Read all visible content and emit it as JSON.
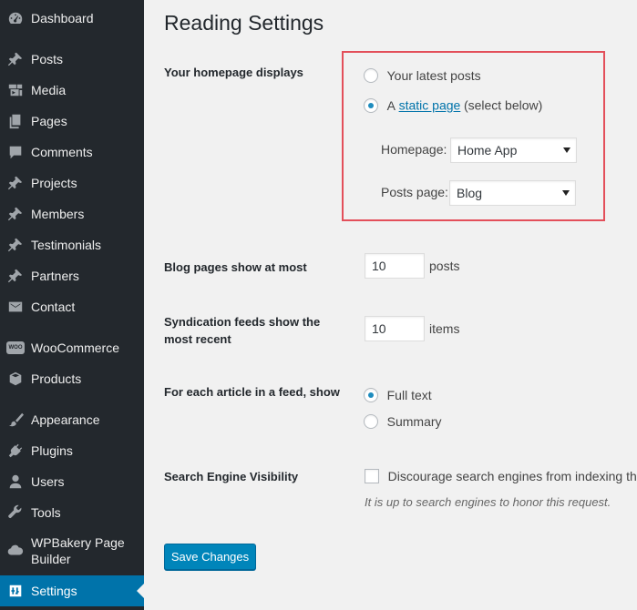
{
  "sidebar": {
    "items": [
      {
        "label": "Dashboard",
        "icon": "dashboard-icon"
      },
      {
        "label": "Posts",
        "icon": "pin-icon"
      },
      {
        "label": "Media",
        "icon": "media-icon"
      },
      {
        "label": "Pages",
        "icon": "pages-icon"
      },
      {
        "label": "Comments",
        "icon": "comment-icon"
      },
      {
        "label": "Projects",
        "icon": "pin-icon"
      },
      {
        "label": "Members",
        "icon": "pin-icon"
      },
      {
        "label": "Testimonials",
        "icon": "pin-icon"
      },
      {
        "label": "Partners",
        "icon": "pin-icon"
      },
      {
        "label": "Contact",
        "icon": "mail-icon"
      },
      {
        "label": "WooCommerce",
        "icon": "woocommerce-icon",
        "icon_text": "WOO"
      },
      {
        "label": "Products",
        "icon": "box-icon"
      },
      {
        "label": "Appearance",
        "icon": "brush-icon"
      },
      {
        "label": "Plugins",
        "icon": "plug-icon"
      },
      {
        "label": "Users",
        "icon": "user-icon"
      },
      {
        "label": "Tools",
        "icon": "wrench-icon"
      },
      {
        "label": "WPBakery Page Builder",
        "icon": "cloud-icon"
      },
      {
        "label": "Settings",
        "icon": "settings-icon",
        "current": true
      }
    ]
  },
  "page": {
    "title": "Reading Settings"
  },
  "homepage_displays": {
    "label": "Your homepage displays",
    "option_latest": "Your latest posts",
    "option_static_prefix": "A",
    "option_static_link": "static page",
    "option_static_suffix": "(select below)",
    "selected": "static",
    "homepage_label": "Homepage:",
    "homepage_value": "Home App",
    "posts_page_label": "Posts page:",
    "posts_page_value": "Blog"
  },
  "blog_pages": {
    "label": "Blog pages show at most",
    "value": "10",
    "suffix": "posts"
  },
  "syndication": {
    "label": "Syndication feeds show the most recent",
    "value": "10",
    "suffix": "items"
  },
  "feed_article": {
    "label": "For each article in a feed, show",
    "option_full": "Full text",
    "option_summary": "Summary",
    "selected": "full"
  },
  "search_visibility": {
    "label": "Search Engine Visibility",
    "checkbox_label": "Discourage search engines from indexing this site",
    "checked": false,
    "hint": "It is up to search engines to honor this request."
  },
  "save_button": "Save Changes",
  "colors": {
    "sidebar_bg": "#23282d",
    "accent": "#0073aa",
    "button": "#0085ba",
    "highlight": "#e34f5a",
    "background": "#f1f1f1"
  }
}
